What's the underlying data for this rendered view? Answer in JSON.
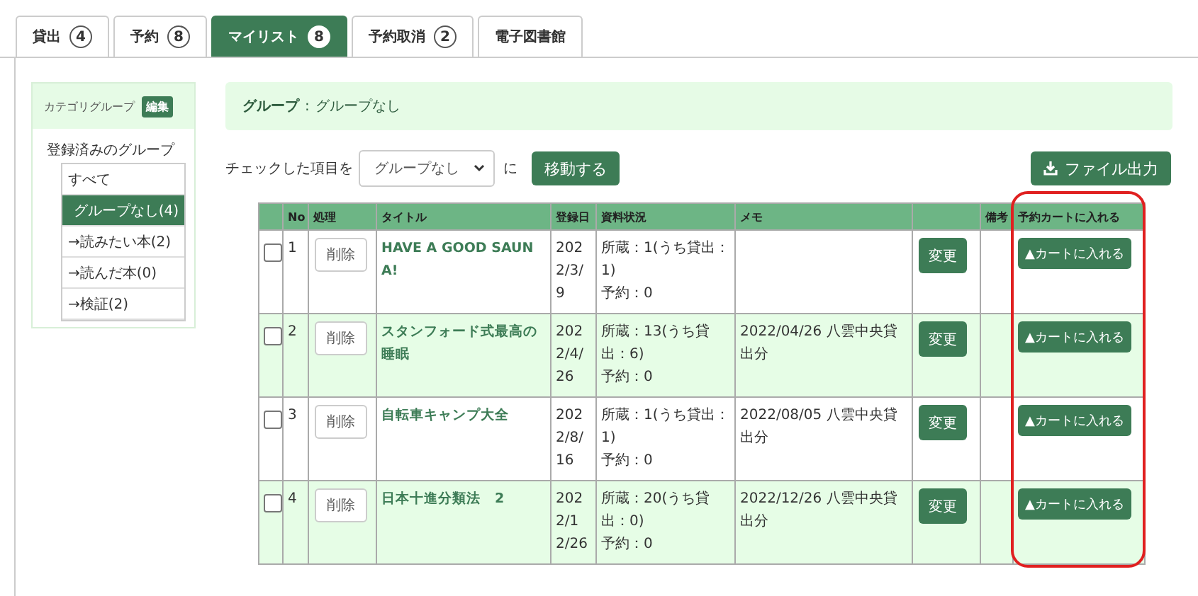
{
  "tabs": [
    {
      "label": "貸出",
      "count": "4",
      "selected": false
    },
    {
      "label": "予約",
      "count": "8",
      "selected": false
    },
    {
      "label": "マイリスト",
      "count": "8",
      "selected": true
    },
    {
      "label": "予約取消",
      "count": "2",
      "selected": false
    },
    {
      "label": "電子図書館",
      "selected": false
    }
  ],
  "sidebar": {
    "title": "カテゴリグループ",
    "edit_button": "編集",
    "heading": "登録済みのグループ",
    "items": [
      {
        "label": "すべて",
        "selected": false
      },
      {
        "label": "グループなし(4)",
        "selected": true
      },
      {
        "label": "→読みたい本(2)",
        "selected": false
      },
      {
        "label": "→読んだ本(0)",
        "selected": false
      },
      {
        "label": "→検証(2)",
        "selected": false
      }
    ]
  },
  "group_banner": {
    "label": "グループ",
    "separator": ":",
    "value": "グループなし"
  },
  "toolbar": {
    "prefix": "チェックした項目を",
    "select_value": "グループなし",
    "suffix": "に",
    "move_button": "移動する",
    "export_button": "ファイル出力"
  },
  "table": {
    "columns": [
      {},
      {
        "label": "No"
      },
      {
        "label": "処理"
      },
      {
        "label": "タイトル"
      },
      {
        "label": "登録日"
      },
      {
        "label": "資料状況"
      },
      {
        "label": "メモ"
      },
      {},
      {
        "label": "備考"
      },
      {
        "label": "予約カートに入れる",
        "highlighted": true
      }
    ],
    "rows": [
      {
        "checked": false,
        "no": "1",
        "delete": "削除",
        "title": "HAVE A GOOD SAUNA!",
        "date": "2022/3/9",
        "holdings": "所蔵：1(うち貸出：1)",
        "reservations": "予約：0",
        "memo": "",
        "change": "変更",
        "cart": "▲カートに入れる"
      },
      {
        "checked": false,
        "no": "2",
        "delete": "削除",
        "title": "スタンフォード式最高の睡眠",
        "date": "2022/4/26",
        "holdings": "所蔵：13(うち貸出：6)",
        "reservations": "予約：0",
        "memo": "2022/04/26 八雲中央貸出分",
        "change": "変更",
        "cart": "▲カートに入れる"
      },
      {
        "checked": false,
        "no": "3",
        "delete": "削除",
        "title": "自転車キャンプ大全",
        "date": "2022/8/16",
        "holdings": "所蔵：1(うち貸出：1)",
        "reservations": "予約：0",
        "memo": "2022/08/05 八雲中央貸出分",
        "change": "変更",
        "cart": "▲カートに入れる"
      },
      {
        "checked": false,
        "no": "4",
        "delete": "削除",
        "title": "日本十進分類法　2",
        "date": "2022/12/26",
        "holdings": "所蔵：20(うち貸出：0)",
        "reservations": "予約：0",
        "memo": "2022/12/26 八雲中央貸出分",
        "change": "変更",
        "cart": "▲カートに入れる"
      }
    ]
  }
}
